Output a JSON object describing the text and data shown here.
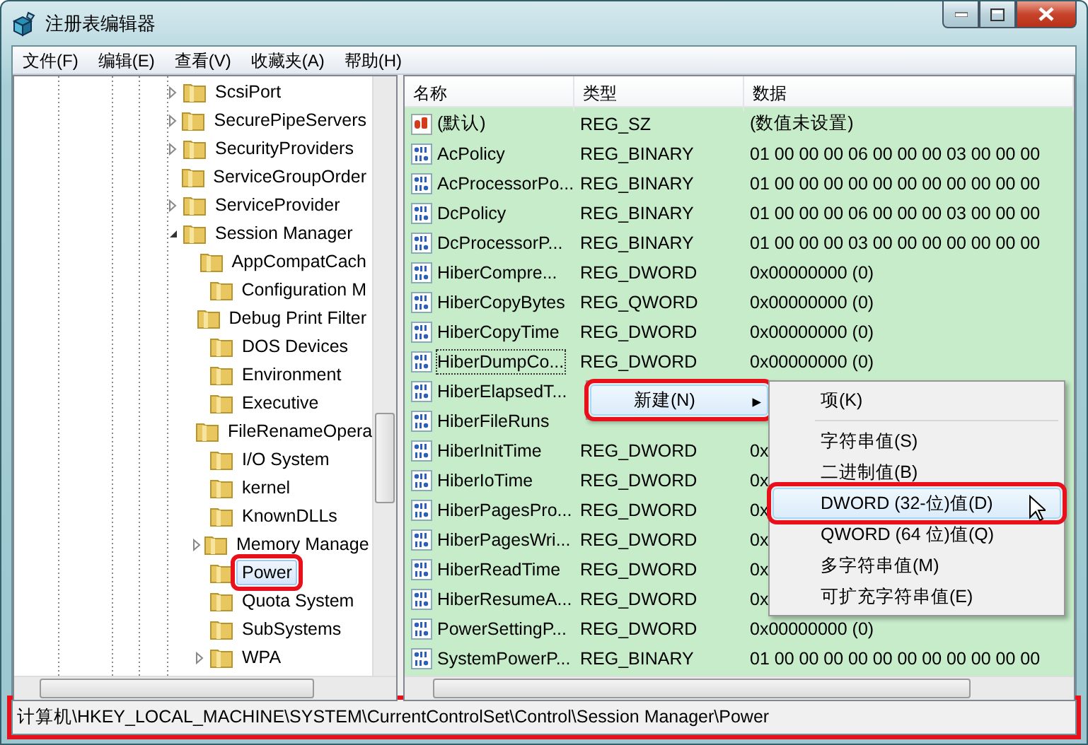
{
  "window": {
    "title": "注册表编辑器"
  },
  "menu": [
    {
      "label": "文件(F)"
    },
    {
      "label": "编辑(E)"
    },
    {
      "label": "查看(V)"
    },
    {
      "label": "收藏夹(A)"
    },
    {
      "label": "帮助(H)"
    }
  ],
  "tree": {
    "items": [
      {
        "label": "ScsiPort",
        "expanded": false,
        "selected": false,
        "annotated": false
      },
      {
        "label": "SecurePipeServers",
        "expanded": false,
        "selected": false,
        "annotated": false
      },
      {
        "label": "SecurityProviders",
        "expanded": false,
        "selected": false,
        "annotated": false
      },
      {
        "label": "ServiceGroupOrder",
        "selected": false,
        "annotated": false
      },
      {
        "label": "ServiceProvider",
        "expanded": false,
        "selected": false,
        "annotated": false
      },
      {
        "label": "Session Manager",
        "expanded": true,
        "selected": false,
        "annotated": false,
        "children": [
          {
            "label": "AppCompatCach",
            "selected": false,
            "annotated": false
          },
          {
            "label": "Configuration M",
            "selected": false,
            "annotated": false
          },
          {
            "label": "Debug Print Filter",
            "selected": false,
            "annotated": false
          },
          {
            "label": "DOS Devices",
            "selected": false,
            "annotated": false
          },
          {
            "label": "Environment",
            "selected": false,
            "annotated": false
          },
          {
            "label": "Executive",
            "selected": false,
            "annotated": false
          },
          {
            "label": "FileRenameOpera",
            "selected": false,
            "annotated": false
          },
          {
            "label": "I/O System",
            "selected": false,
            "annotated": false
          },
          {
            "label": "kernel",
            "selected": false,
            "annotated": false
          },
          {
            "label": "KnownDLLs",
            "selected": false,
            "annotated": false
          },
          {
            "label": "Memory Manage",
            "expanded": false,
            "selected": false,
            "annotated": false
          },
          {
            "label": "Power",
            "selected": true,
            "annotated": true
          },
          {
            "label": "Quota System",
            "selected": false,
            "annotated": false
          },
          {
            "label": "SubSystems",
            "selected": false,
            "annotated": false
          },
          {
            "label": "WPA",
            "expanded": false,
            "selected": false,
            "annotated": false
          }
        ]
      }
    ]
  },
  "values": {
    "columns": [
      "名称",
      "类型",
      "数据"
    ],
    "rows": [
      {
        "kind": "string",
        "name": "(默认)",
        "type": "REG_SZ",
        "data": "(数值未设置)",
        "focused": false
      },
      {
        "kind": "binary",
        "name": "AcPolicy",
        "type": "REG_BINARY",
        "data": "01 00 00 00 06 00 00 00 03 00 00 00",
        "focused": false
      },
      {
        "kind": "binary",
        "name": "AcProcessorPo...",
        "type": "REG_BINARY",
        "data": "01 00 00 00 00 00 00 00 00 00 00 00",
        "focused": false
      },
      {
        "kind": "binary",
        "name": "DcPolicy",
        "type": "REG_BINARY",
        "data": "01 00 00 00 06 00 00 00 03 00 00 00",
        "focused": false
      },
      {
        "kind": "binary",
        "name": "DcProcessorP...",
        "type": "REG_BINARY",
        "data": "01 00 00 00 03 00 00 00 00 00 00 00",
        "focused": false
      },
      {
        "kind": "binary",
        "name": "HiberCompre...",
        "type": "REG_DWORD",
        "data": "0x00000000 (0)",
        "focused": false
      },
      {
        "kind": "binary",
        "name": "HiberCopyBytes",
        "type": "REG_QWORD",
        "data": "0x00000000 (0)",
        "focused": false
      },
      {
        "kind": "binary",
        "name": "HiberCopyTime",
        "type": "REG_DWORD",
        "data": "0x00000000 (0)",
        "focused": false
      },
      {
        "kind": "binary",
        "name": "HiberDumpCo...",
        "type": "REG_DWORD",
        "data": "0x00000000 (0)",
        "focused": true
      },
      {
        "kind": "binary",
        "name": "HiberElapsedT...",
        "focused": false
      },
      {
        "kind": "binary",
        "name": "HiberFileRuns",
        "focused": false
      },
      {
        "kind": "binary",
        "name": "HiberInitTime",
        "type": "REG_DWORD",
        "data": "0x",
        "focused": false
      },
      {
        "kind": "binary",
        "name": "HiberIoTime",
        "type": "REG_DWORD",
        "data": "0x",
        "focused": false
      },
      {
        "kind": "binary",
        "name": "HiberPagesPro...",
        "type": "REG_DWORD",
        "data": "0x",
        "focused": false
      },
      {
        "kind": "binary",
        "name": "HiberPagesWri...",
        "type": "REG_DWORD",
        "data": "0x",
        "focused": false
      },
      {
        "kind": "binary",
        "name": "HiberReadTime",
        "type": "REG_DWORD",
        "data": "0x",
        "focused": false
      },
      {
        "kind": "binary",
        "name": "HiberResumeA...",
        "type": "REG_DWORD",
        "data": "0x",
        "focused": false
      },
      {
        "kind": "binary",
        "name": "PowerSettingP...",
        "type": "REG_DWORD",
        "data": "0x00000000 (0)",
        "focused": false
      },
      {
        "kind": "binary",
        "name": "SystemPowerP...",
        "type": "REG_BINARY",
        "data": "01 00 00 00 00 00 00 00 00 00 00 00",
        "focused": false
      }
    ]
  },
  "context_menu": {
    "items": [
      {
        "label": "新建(N)",
        "arrow": "▸",
        "selected": true,
        "annotated": true
      }
    ]
  },
  "submenu": {
    "items": [
      {
        "kind": "item",
        "label": "项(K)",
        "selected": false,
        "annotated": false
      },
      {
        "kind": "separator"
      },
      {
        "kind": "item",
        "label": "字符串值(S)",
        "selected": false,
        "annotated": false
      },
      {
        "kind": "item",
        "label": "二进制值(B)",
        "selected": false,
        "annotated": false
      },
      {
        "kind": "item",
        "label": "DWORD (32-位)值(D)",
        "selected": true,
        "annotated": true
      },
      {
        "kind": "item",
        "label": "QWORD (64 位)值(Q)",
        "selected": false,
        "annotated": false
      },
      {
        "kind": "item",
        "label": "多字符串值(M)",
        "selected": false,
        "annotated": false
      },
      {
        "kind": "item",
        "label": "可扩充字符串值(E)",
        "selected": false,
        "annotated": false
      }
    ]
  },
  "status_bar": {
    "path": "计算机\\HKEY_LOCAL_MACHINE\\SYSTEM\\CurrentControlSet\\Control\\Session Manager\\Power",
    "annotated": true
  }
}
